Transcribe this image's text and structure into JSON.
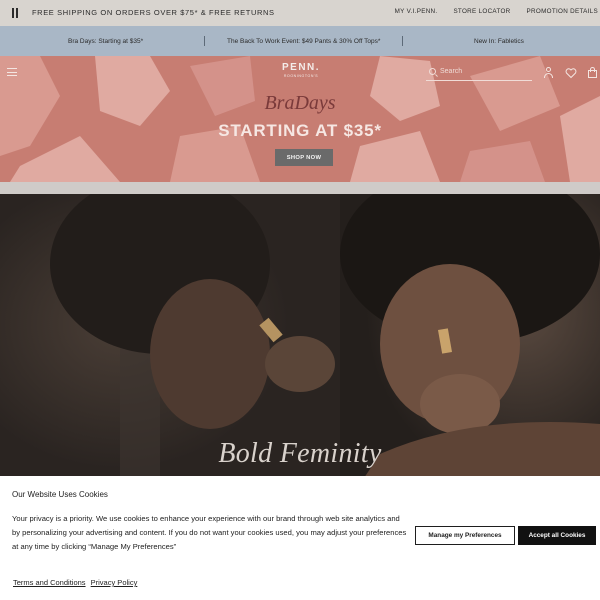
{
  "top_bar": {
    "shipping_text": "FREE SHIPPING ON ORDERS OVER $75* & FREE RETURNS",
    "links": [
      "MY V.I.PENN.",
      "STORE LOCATOR",
      "PROMOTION DETAILS"
    ]
  },
  "promo_bar": {
    "items": [
      "Bra Days: Starting at $35*",
      "The Back To Work Event: $49 Pants & 30% Off Tops*",
      "New In: Fabletics"
    ],
    "background": "#a9b7c6"
  },
  "header": {
    "logo_line1": "PENN.",
    "logo_line2": "ROONINGTON'S",
    "search_placeholder": "Search",
    "icons": [
      "menu-icon",
      "search-icon",
      "account-icon",
      "heart-icon",
      "bag-icon"
    ]
  },
  "hero": {
    "title": "BraDays",
    "subtitle": "STARTING AT $35*",
    "cta": "SHOP NOW",
    "background": "#c77d72"
  },
  "lifestyle": {
    "caption": "Bold Feminity"
  },
  "cookie_banner": {
    "title": "Our Website Uses Cookies",
    "body": "Your privacy is a priority. We use cookies to enhance your experience with our brand through web site analytics and by personalizing your advertising and content. If you do not want your cookies used, you may adjust your preferences at any time by clicking “Manage My Preferences”",
    "link_terms": "Terms and Conditions",
    "link_privacy": "Privacy Policy",
    "btn_manage": "Manage my Preferences",
    "btn_accept": "Accept all Cookies"
  }
}
